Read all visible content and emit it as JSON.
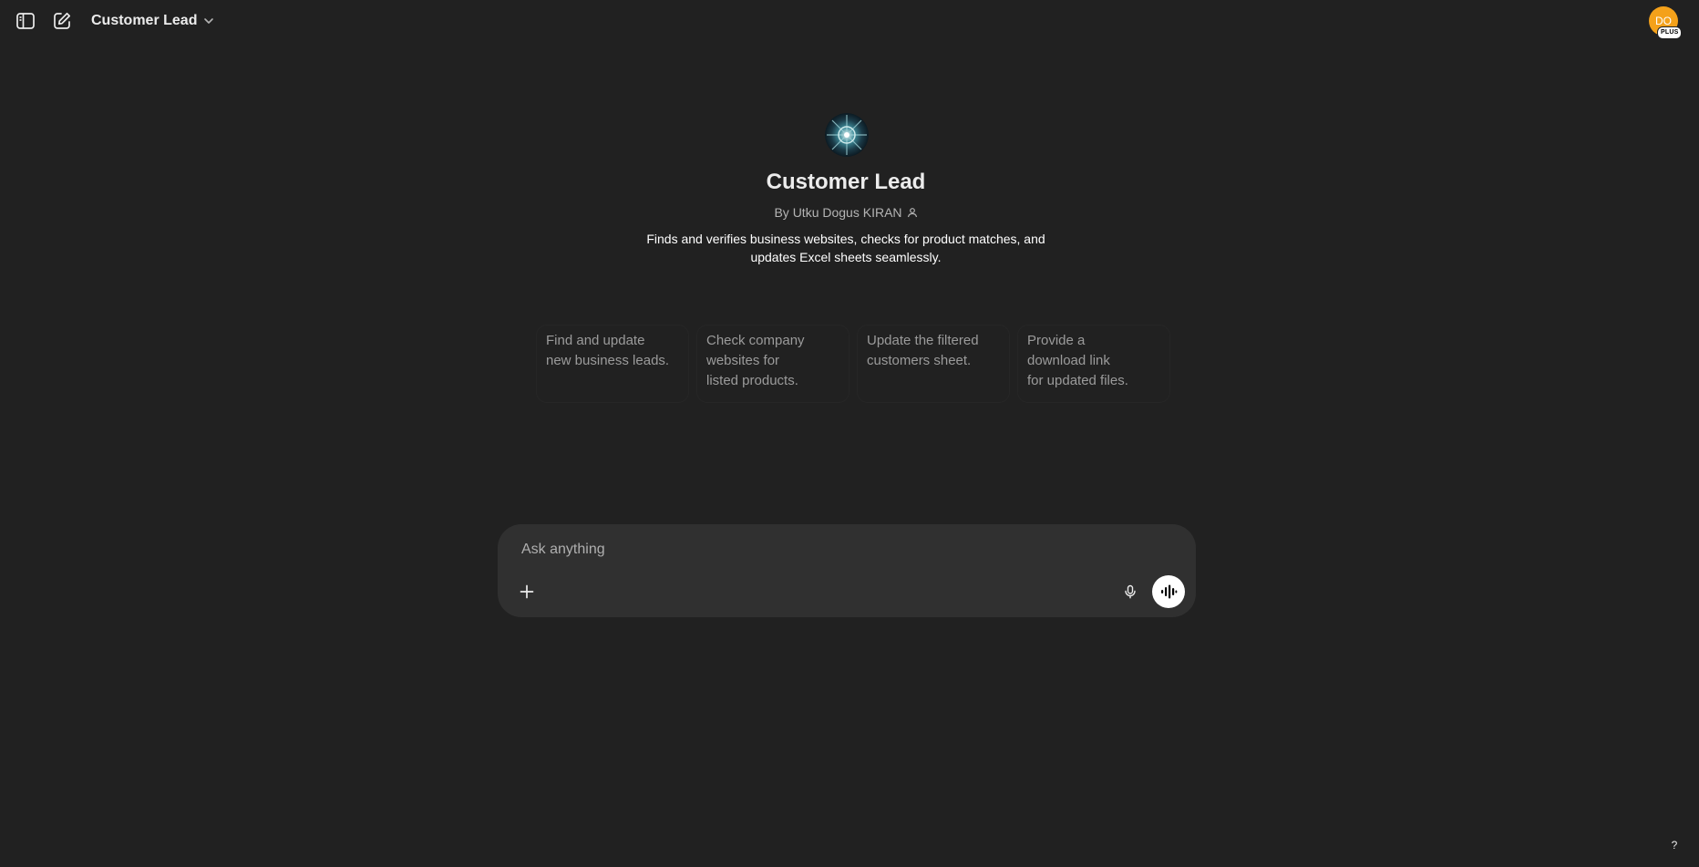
{
  "header": {
    "sidebar_toggle_icon": "sidebar-icon",
    "new_chat_icon": "new-chat-icon",
    "model_title": "Customer Lead",
    "chevron_icon": "chevron-down-icon",
    "avatar_initials": "DO",
    "plan_badge": "PLUS",
    "avatar_color": "#f4a11a"
  },
  "gpt": {
    "name": "Customer Lead",
    "author": "By Utku Dogus KIRAN",
    "author_icon": "person-icon",
    "description": "Finds and verifies business websites, checks for product matches, and updates Excel sheets seamlessly."
  },
  "starters": [
    {
      "label": "Find and update\nnew business leads."
    },
    {
      "label": "Check company\nwebsites for\nlisted products."
    },
    {
      "label": "Update the filtered\ncustomers sheet."
    },
    {
      "label": "Provide a\ndownload link\nfor updated files."
    }
  ],
  "composer": {
    "placeholder": "Ask anything",
    "attach_icon": "plus-icon",
    "mic_icon": "microphone-icon",
    "voice_icon": "voice-mode-icon"
  },
  "help": {
    "label": "?"
  },
  "colors": {
    "background": "#212121",
    "composer": "#303030",
    "text": "#ececec",
    "muted": "#9b9b9b"
  }
}
